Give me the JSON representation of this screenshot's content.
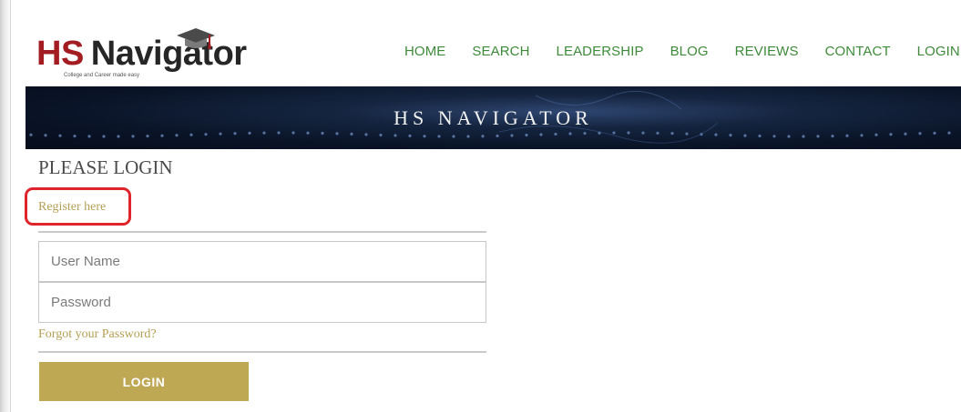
{
  "header": {
    "logo": {
      "hs": "HS",
      "name": "Navigator",
      "tagline": "College and Career made easy"
    },
    "nav": [
      "HOME",
      "SEARCH",
      "LEADERSHIP",
      "BLOG",
      "REVIEWS",
      "CONTACT",
      "LOGIN"
    ],
    "nav_color": "#3e8a3a"
  },
  "banner": {
    "title": "HS NAVIGATOR"
  },
  "login": {
    "heading": "PLEASE LOGIN",
    "register_link": "Register here",
    "username_placeholder": "User Name",
    "password_placeholder": "Password",
    "forgot_link": "Forgot your Password?",
    "button_label": "LOGIN"
  },
  "colors": {
    "brand_red": "#a31c22",
    "accent_gold": "#bea854",
    "link_gold": "#b59f55",
    "highlight_red": "#e0242c"
  }
}
